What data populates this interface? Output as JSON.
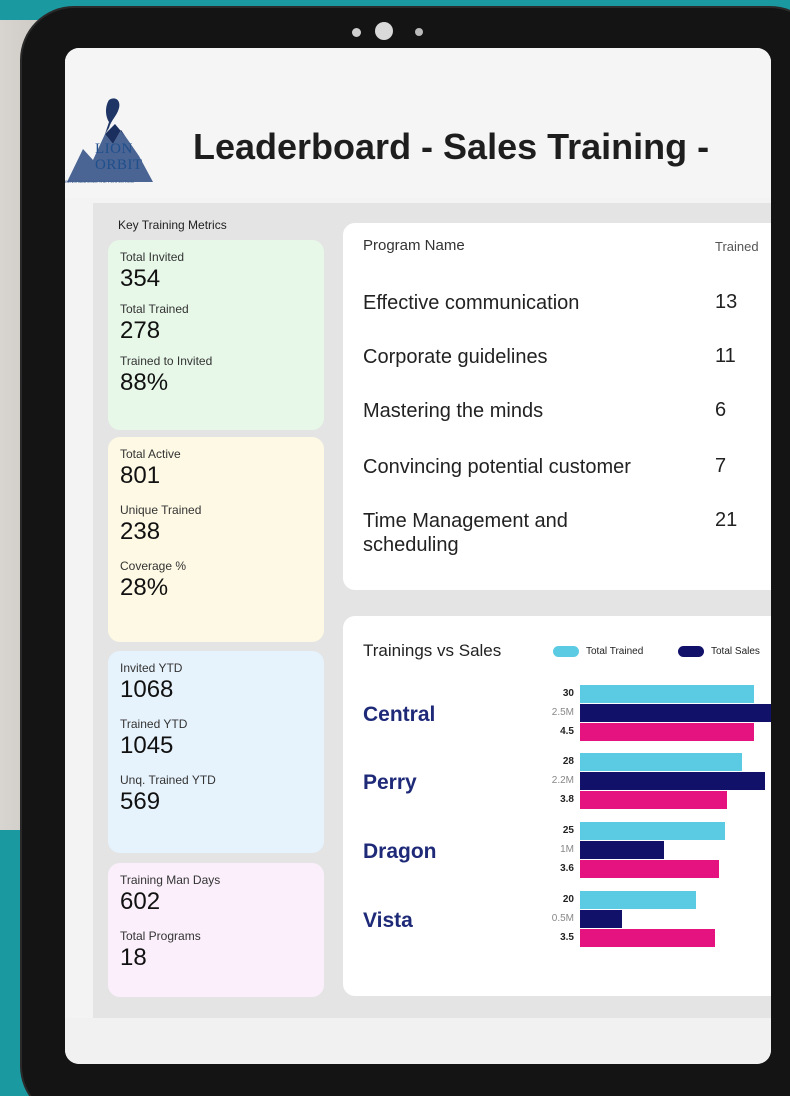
{
  "header": {
    "title": "Leaderboard - Sales Training -",
    "logo_line1": "LION",
    "logo_line2": "ORBIT",
    "logo_tagline": "BENCHMARKING THE PERFECTION"
  },
  "metrics": {
    "section_title": "Key Training Metrics",
    "cards": [
      {
        "items": [
          {
            "label": "Total Invited",
            "value": "354"
          },
          {
            "label": "Total Trained",
            "value": "278"
          },
          {
            "label": "Trained to Invited",
            "value": "88%"
          }
        ]
      },
      {
        "items": [
          {
            "label": "Total Active",
            "value": "801"
          },
          {
            "label": "Unique Trained",
            "value": "238"
          },
          {
            "label": "Coverage %",
            "value": "28%"
          }
        ]
      },
      {
        "items": [
          {
            "label": "Invited YTD",
            "value": "1068"
          },
          {
            "label": "Trained YTD",
            "value": "1045"
          },
          {
            "label": "Unq. Trained YTD",
            "value": "569"
          }
        ]
      },
      {
        "items": [
          {
            "label": "Training Man Days",
            "value": "602"
          },
          {
            "label": "Total Programs",
            "value": "18"
          }
        ]
      }
    ]
  },
  "programs": {
    "header_name": "Program Name",
    "header_trained": "Trained",
    "rows": [
      {
        "name": "Effective communication",
        "trained": "13"
      },
      {
        "name": "Corporate guidelines",
        "trained": "11"
      },
      {
        "name": "Mastering the minds",
        "trained": "6"
      },
      {
        "name": "Convincing potential customer",
        "trained": "7"
      },
      {
        "name": "Time Management and scheduling",
        "trained": "21"
      }
    ]
  },
  "chart_data": {
    "type": "bar",
    "title": "Trainings vs Sales",
    "categories": [
      "Central",
      "Perry",
      "Dragon",
      "Vista"
    ],
    "series": [
      {
        "name": "Total Trained",
        "values": [
          30,
          28,
          25,
          20
        ],
        "labels": [
          "30",
          "28",
          "25",
          "20"
        ],
        "color": "#5bcbe3"
      },
      {
        "name": "Total Sales",
        "values": [
          2.5,
          2.2,
          1.0,
          0.5
        ],
        "labels": [
          "2.5M",
          "2.2M",
          "1M",
          "0.5M"
        ],
        "color": "#12116a"
      },
      {
        "name": "",
        "values": [
          4.5,
          3.8,
          3.6,
          3.5
        ],
        "labels": [
          "4.5",
          "3.8",
          "3.6",
          "3.5"
        ],
        "color": "#e5137f"
      }
    ]
  }
}
